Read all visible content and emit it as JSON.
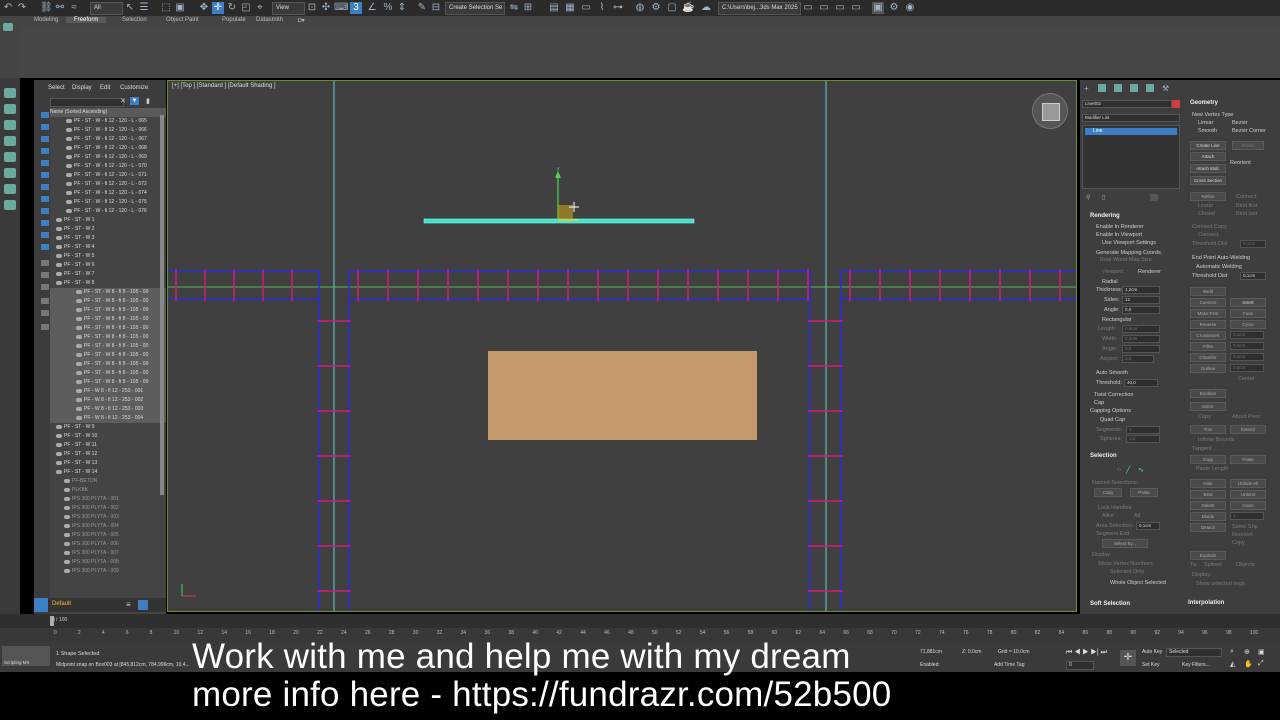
{
  "toolbar": {
    "selection_filter": "All",
    "view_dropdown": "View",
    "named_selection": "Create Selection Se",
    "project_path": "C:\\Users\\bej...3ds Max 2025"
  },
  "ribbon": {
    "tabs": [
      "Modeling",
      "Freeform",
      "Selection",
      "Object Paint",
      "Populate",
      "Datasmith"
    ],
    "active_tab": "Freeform"
  },
  "scene_explorer": {
    "menu": [
      "Select",
      "Display",
      "Edit",
      "Customize"
    ],
    "column_header": "Name (Sorted Ascending)",
    "rows": [
      "PF - ST - W - fi 12 - 120 - L - 065",
      "PF - ST - W - fi 12 - 120 - L - 066",
      "PF - ST - W - fi 12 - 120 - L - 067",
      "PF - ST - W - fi 12 - 120 - L - 068",
      "PF - ST - W - fi 12 - 120 - L - 069",
      "PF - ST - W - fi 12 - 120 - L - 070",
      "PF - ST - W - fi 12 - 120 - L - 071",
      "PF - ST - W - fi 12 - 120 - L - 072",
      "PF - ST - W - fi 12 - 120 - L - 074",
      "PF - ST - W - fi 12 - 120 - L - 075",
      "PF - ST - W - fi 12 - 120 - L - 076",
      "PF - ST - W 1",
      "PF - ST - W 2",
      "PF - ST - W 3",
      "PF - ST - W 4",
      "PF - ST - W 5",
      "PF - ST - W 6",
      "PF - ST - W 7",
      "PF - ST - W 8",
      "PF - ST - W 8 - fi 8 - 105 - 00",
      "PF - ST - W 8 - fi 8 - 105 - 00",
      "PF - ST - W 8 - fi 8 - 105 - 00",
      "PF - ST - W 8 - fi 8 - 105 - 00",
      "PF - ST - W 8 - fi 8 - 105 - 00",
      "PF - ST - W 8 - fi 8 - 105 - 00",
      "PF - ST - W 8 - fi 8 - 105 - 00",
      "PF - ST - W 8 - fi 8 - 105 - 00",
      "PF - ST - W 8 - fi 8 - 105 - 00",
      "PF - ST - W 8 - fi 8 - 105 - 00",
      "PF - ST - W 8 - fi 8 - 105 - 00",
      "PF - W 8 - fi 12 - 253 - 001",
      "PF - W 8 - fi 12 - 253 - 002",
      "PF - W 8 - fi 12 - 253 - 003",
      "PF - W 8 - fi 12 - 253 - 004",
      "PF - ST - W 9",
      "PF - ST - W 10",
      "PF - ST - W 11",
      "PF - ST - W 12",
      "PF - ST - W 13",
      "PF - ST - W 14",
      "PF-BETON",
      "PLKBK",
      "IPS 300 PLYTA - 001",
      "IPS 300 PLYTA - 002",
      "IPS 300 PLYTA - 003",
      "IPS 300 PLYTA - 004",
      "IPS 300 PLYTA - 005",
      "IPS 300 PLYTA - 006",
      "IPS 300 PLYTA - 007",
      "IPS 300 PLYTA - 008",
      "IPS 300 PLYTA - 009"
    ],
    "layer": "Default"
  },
  "viewport": {
    "label": "[+] [Top ] [Standard ] [Default Shading ]"
  },
  "command_panel": {
    "object_name": "Line002",
    "modifier_list": "Modifier List",
    "stack_item": "Line",
    "geometry": {
      "title": "Geometry",
      "new_vertex_type": "New Vertex Type",
      "linear": "Linear",
      "bezier": "Bezier",
      "smooth": "Smooth",
      "bezier_corner": "Bezier Corner",
      "create_line": "Create Line",
      "break": "Break",
      "attach": "Attach",
      "reorient": "Reorient",
      "attach_mult": "Attach Mult.",
      "cross_section": "Cross Section",
      "refine": "Refine",
      "connect": "Connect",
      "linear2": "Linear",
      "bind_first": "Bind first",
      "closed": "Closed",
      "bind_last": "Bind last",
      "connect_copy": "Connect Copy",
      "connect2": "Connect",
      "threshold_dist": "Threshold Dist",
      "threshold_val": "0,1cm",
      "end_point_auto": "End Point Auto-Welding",
      "auto_weld": "Automatic Welding",
      "weld_threshold": "Threshold Dist",
      "weld_threshold_val": "0,1cm",
      "weld": "Weld",
      "connect3": "Connect",
      "insert": "Insert",
      "make_first": "Make First",
      "fuse": "Fuse",
      "reverse": "Reverse",
      "cycle": "Cycle",
      "crossinsert": "CrossInsert",
      "crossinsert_val": "0,1cm",
      "fillet": "Fillet",
      "fillet_val": "0,0cm",
      "chamfer": "Chamfer",
      "chamfer_val": "0,0cm",
      "outline": "Outline",
      "outline_val": "0,0cm",
      "center": "Center",
      "boolean": "Boolean",
      "mirror": "Mirror",
      "copy": "Copy",
      "about_pivot": "About Pivot",
      "trim": "Trim",
      "extend": "Extend",
      "infinite_bounds": "Infinite Bounds",
      "tangent": "Tangent",
      "tan_copy": "Copy",
      "tan_paste": "Paste",
      "paste_length": "Paste Length",
      "hide": "Hide",
      "unhide_all": "Unhide All",
      "bind": "Bind",
      "unbind": "Unbind",
      "delete": "Delete",
      "close": "Close",
      "divide": "Divide",
      "divide_val": "1",
      "detach": "Detach",
      "same_shp": "Same Shp",
      "reorient2": "Reorient",
      "copy2": "Copy",
      "explode": "Explode",
      "to": "To:",
      "splines": "Splines",
      "objects": "Objects",
      "display": "Display:",
      "show_sel_segs": "Show selected segs"
    },
    "rendering": {
      "title": "Rendering",
      "enable_render": "Enable In Renderer",
      "enable_viewport": "Enable In Viewport",
      "use_viewport": "Use Viewport Settings",
      "gen_mapping": "Generate Mapping Coords.",
      "real_world": "Real-World Map Size",
      "viewport": "Viewport",
      "renderer": "Renderer",
      "radial": "Radial",
      "thickness_lbl": "Thickness:",
      "thickness_val": "1,2cm",
      "sides_lbl": "Sides:",
      "sides_val": "12",
      "angle_lbl": "Angle:",
      "angle_val": "0,0",
      "rectangular": "Rectangular",
      "length_lbl": "Length:",
      "length_val": "0,6cm",
      "width_lbl": "Width:",
      "width_val": "0,2cm",
      "angle2_lbl": "Angle:",
      "angle2_val": "0,0",
      "aspect_lbl": "Aspect:",
      "aspect_val": "3,0",
      "auto_smooth": "Auto Smooth",
      "threshold_lbl": "Threshold:",
      "threshold_val": "40,0",
      "twist": "Twist Correction",
      "cap": "Cap",
      "capping": "Capping Options",
      "quad_cap": "Quad Cap",
      "segments_lbl": "Segments:",
      "segments_val": "1",
      "spheres_lbl": "Spheres:",
      "spheres_val": "1,0"
    },
    "selection": {
      "title": "Selection",
      "named_selections": "Named Selections:",
      "copy": "Copy",
      "paste": "Paste",
      "lock_handles": "Lock Handles",
      "alike": "Alike",
      "all": "All",
      "area_selection": "Area Selection:",
      "area_val": "0,1cm",
      "segment_end": "Segment End",
      "select_by": "Select By...",
      "display": "Display",
      "show_vertex_numbers": "Show Vertex Numbers",
      "selected_only": "Selected Only",
      "status": "Whole Object Selected"
    },
    "soft_selection": "Soft Selection",
    "interpolation": "Interpolation"
  },
  "timeline": {
    "frame": "0 / 100",
    "ticks": [
      "0",
      "2",
      "4",
      "6",
      "8",
      "10",
      "12",
      "14",
      "16",
      "18",
      "20",
      "22",
      "24",
      "26",
      "28",
      "30",
      "32",
      "34",
      "36",
      "38",
      "40",
      "42",
      "44",
      "46",
      "48",
      "50",
      "52",
      "54",
      "56",
      "58",
      "60",
      "62",
      "64",
      "66",
      "68",
      "70",
      "72",
      "74",
      "76",
      "78",
      "80",
      "82",
      "84",
      "86",
      "88",
      "90",
      "92",
      "94",
      "96",
      "98",
      "100"
    ]
  },
  "status": {
    "selected": "1 Shape Selected",
    "prompt": "Midpoint snap on Box003 at [845,812cm, 784,996cm, 10,4...",
    "x_coord": "71,881cm",
    "z_coord": "Z: 0,0cm",
    "grid": "Grid = 10,0cm",
    "enabled": "Enabled:",
    "add_time_tag": "Add Time Tag",
    "auto_key": "Auto Key",
    "set_key": "Set Key",
    "selected_dd": "Selected",
    "key_filters": "Key Filters...",
    "frame_field": "0",
    "scripting": "Scripting MX"
  },
  "caption": {
    "line1": "Work with me and help me with my dream",
    "line2": "more info here - https://fundrazr.com/52b500"
  },
  "colors": {
    "viewport_bg": "#404040",
    "box_fill": "#c49a6c",
    "line_cyan": "#3fe3c8",
    "rebar_blue": "#2a2ad8",
    "rebar_magenta": "#d01a7a",
    "guide_cyan": "#5fd4d0",
    "guide_green": "#4fb84f"
  }
}
